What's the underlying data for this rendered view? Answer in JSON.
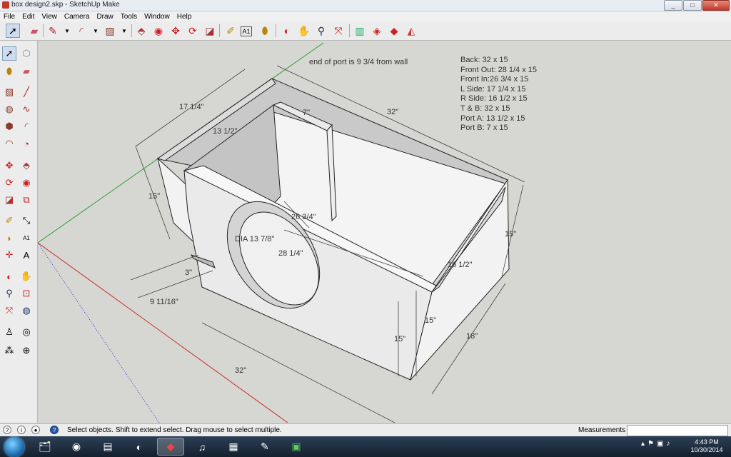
{
  "window": {
    "title": "box design2.skp - SketchUp Make",
    "minimize_icon": "minimize-icon",
    "maximize_icon": "maximize-icon",
    "close_icon": "close-icon"
  },
  "menu": [
    "File",
    "Edit",
    "View",
    "Camera",
    "Draw",
    "Tools",
    "Window",
    "Help"
  ],
  "toolbar_icons": [
    "select-icon",
    "eraser-icon",
    "pencil-line-icon",
    "arc-icon",
    "rectangle-icon",
    "push-pull-icon",
    "follow-me-icon",
    "move-icon",
    "rotate-icon",
    "scale-icon",
    "tape-measure-icon",
    "text-icon",
    "paint-bucket-icon",
    "orbit-icon",
    "pan-icon",
    "zoom-icon",
    "zoom-extents-icon",
    "get-models-icon",
    "share-model-icon",
    "extension-warehouse-icon",
    "layout-icon"
  ],
  "left_tool_icons": [
    "select-icon",
    "component-icon",
    "paint-bucket-icon",
    "eraser-icon",
    "rectangle-icon",
    "line-icon",
    "circle-icon",
    "freehand-icon",
    "polygon-icon",
    "arc-icon",
    "two-point-arc-icon",
    "pie-icon",
    "move-icon",
    "push-pull-icon",
    "rotate-icon",
    "follow-me-icon",
    "scale-icon",
    "offset-icon",
    "tape-measure-icon",
    "dimension-icon",
    "protractor-icon",
    "text-icon",
    "axes-icon",
    "3d-text-icon",
    "orbit-icon",
    "pan-icon",
    "zoom-icon",
    "zoom-window-icon",
    "zoom-extents-icon",
    "previous-view-icon",
    "position-camera-icon",
    "look-around-icon",
    "walk-icon",
    "section-plane-icon"
  ],
  "model": {
    "note": "end of port is 9 3/4 from wall",
    "cut_list": [
      "Back: 32 x 15",
      "Front Out: 28 1/4 x 15",
      "Front In:26 3/4 x 15",
      "L Side: 17 1/4 x 15",
      "R Side: 16 1/2 x 15",
      "T & B: 32 x 15",
      "Port A: 13 1/2 x 15",
      "Port B: 7 x 15"
    ],
    "dimensions": {
      "depth_left": "17 1/4\"",
      "port_a": "13 1/2\"",
      "port_b": "7\"",
      "top_length": "32\"",
      "height_left": "15\"",
      "front_in": "26 3/4\"",
      "hole": "DIA 13 7/8\"",
      "front_out": "28 1/4\"",
      "port_width": "3\"",
      "offset": "9 11/16\"",
      "right_side": "16 1/2\"",
      "height_right": "15\"",
      "height_front": "15\"",
      "height_front_inner": "15\"",
      "depth_right": "18\"",
      "bottom_length": "32\""
    }
  },
  "status": {
    "text": "Select objects. Shift to extend select. Drag mouse to select multiple.",
    "measurements_label": "Measurements",
    "measurements_value": ""
  },
  "taskbar": {
    "apps": [
      "explorer-icon",
      "chrome-icon",
      "folder-icon",
      "media-icon",
      "sketchup-icon",
      "audio-icon",
      "calculator-icon",
      "paint-icon",
      "app-icon"
    ],
    "time": "4:43 PM",
    "date": "10/30/2014"
  },
  "colors": {
    "viewport_bg": "#d6d6d2",
    "x_axis": "#cc2b2b",
    "y_axis": "#2fa12f",
    "blue_axis": "#3a3ad0",
    "taskbar": "#1c2a3a"
  }
}
